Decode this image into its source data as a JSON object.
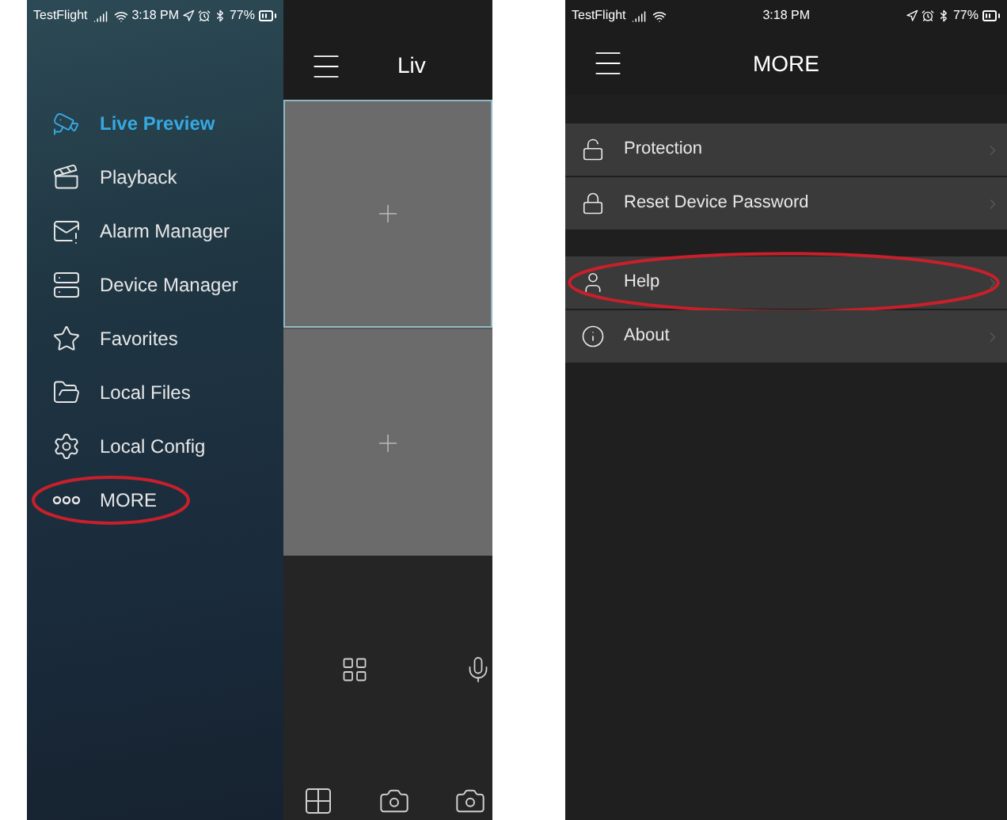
{
  "left_phone": {
    "status_bar": {
      "carrier": "TestFlight",
      "time": "3:18 PM",
      "battery": "77%"
    },
    "drawer": {
      "items": [
        {
          "label": "Live Preview",
          "selected": true,
          "highlighted": false
        },
        {
          "label": "Playback",
          "selected": false,
          "highlighted": false
        },
        {
          "label": "Alarm Manager",
          "selected": false,
          "highlighted": false
        },
        {
          "label": "Device Manager",
          "selected": false,
          "highlighted": false
        },
        {
          "label": "Favorites",
          "selected": false,
          "highlighted": false
        },
        {
          "label": "Local Files",
          "selected": false,
          "highlighted": false
        },
        {
          "label": "Local Config",
          "selected": false,
          "highlighted": false
        },
        {
          "label": "MORE",
          "selected": false,
          "highlighted": true
        }
      ]
    },
    "live_view": {
      "title": "Liv",
      "tiles": [
        {
          "selected": true
        },
        {
          "selected": false
        }
      ]
    }
  },
  "right_phone": {
    "status_bar": {
      "carrier": "TestFlight",
      "time": "3:18 PM",
      "battery": "77%"
    },
    "title": "MORE",
    "groups": [
      [
        {
          "label": "Protection",
          "highlighted": false
        },
        {
          "label": "Reset Device Password",
          "highlighted": false
        }
      ],
      [
        {
          "label": "Help",
          "highlighted": true
        },
        {
          "label": "About",
          "highlighted": false
        }
      ]
    ]
  }
}
